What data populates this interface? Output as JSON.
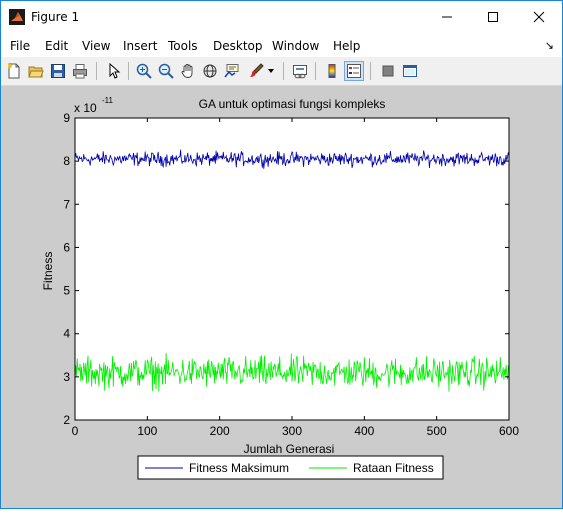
{
  "window": {
    "title": "Figure 1",
    "controls": {
      "minimize": "minimize",
      "maximize": "maximize",
      "close": "close"
    }
  },
  "menu": {
    "items": [
      "File",
      "Edit",
      "View",
      "Insert",
      "Tools",
      "Desktop",
      "Window",
      "Help"
    ],
    "dock_arrow": "↘"
  },
  "toolbar": {
    "buttons": [
      "new-figure-icon",
      "open-file-icon",
      "save-icon",
      "print-icon",
      "edit-plot-arrow-icon",
      "zoom-in-icon",
      "zoom-out-icon",
      "pan-hand-icon",
      "rotate-3d-icon",
      "data-cursor-icon",
      "brush-icon",
      "link-plot-icon",
      "insert-colorbar-icon",
      "insert-legend-icon",
      "hide-plot-tools-icon",
      "show-plot-tools-icon"
    ]
  },
  "chart_data": {
    "type": "line",
    "title": "GA untuk optimasi fungsi kompleks",
    "xlabel": "Jumlah Generasi",
    "ylabel": "Fitness",
    "y_exponent_label": "x 10",
    "y_exponent": "-11",
    "xlim": [
      0,
      600
    ],
    "ylim": [
      2,
      9
    ],
    "xticks": [
      "0",
      "100",
      "200",
      "300",
      "400",
      "500",
      "600"
    ],
    "yticks": [
      "2",
      "3",
      "4",
      "5",
      "6",
      "7",
      "8",
      "9"
    ],
    "grid": false,
    "legend_position": "bottom-center",
    "series": [
      {
        "name": "Fitness Maksimum",
        "color": "#0000aa",
        "mean": 8.05,
        "spread": 0.1,
        "samples": 600,
        "x_range": [
          0,
          600
        ]
      },
      {
        "name": "Rataan Fitness",
        "color": "#00ee00",
        "mean": 3.1,
        "spread": 0.22,
        "samples": 600,
        "x_range": [
          0,
          600
        ]
      }
    ]
  }
}
